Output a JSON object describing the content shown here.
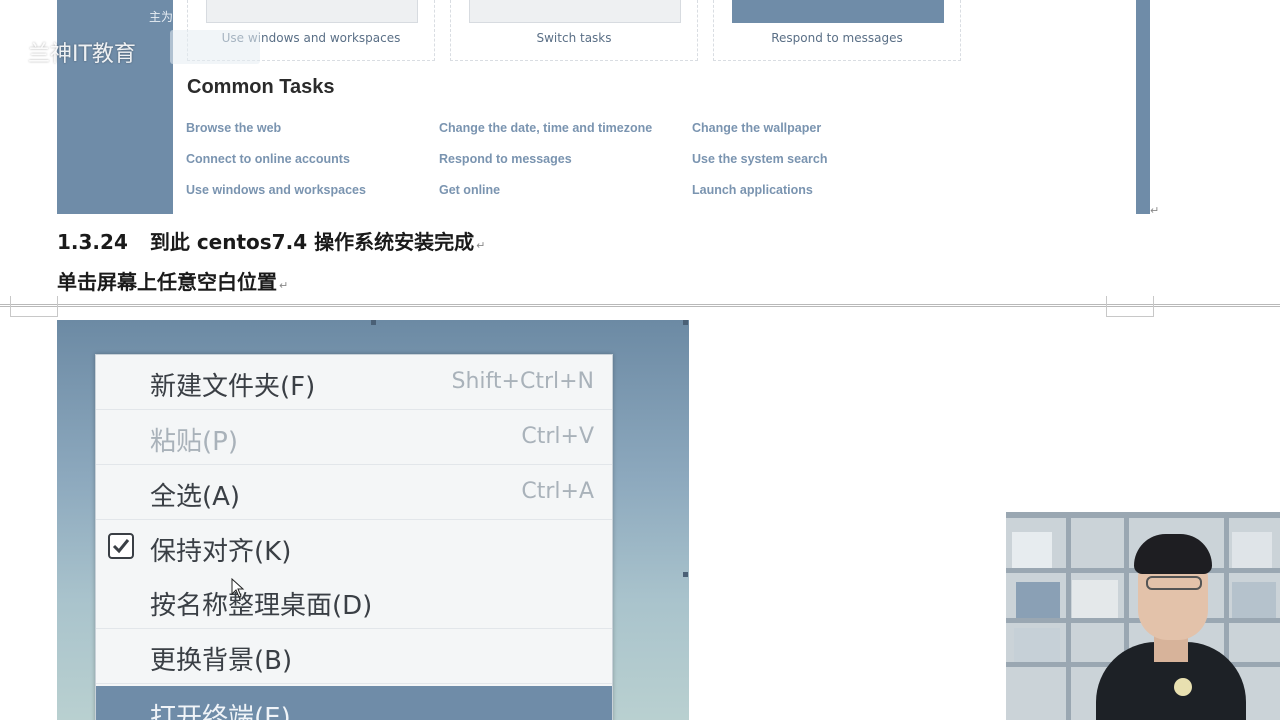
{
  "help_screenshot": {
    "sidebar_text": "主为",
    "cards": [
      {
        "caption": "Use windows and workspaces"
      },
      {
        "caption": "Switch tasks"
      },
      {
        "caption": "Respond to messages"
      }
    ],
    "common_tasks_title": "Common Tasks",
    "links": [
      [
        "Browse the web",
        "Change the date, time and timezone",
        "Change the wallpaper"
      ],
      [
        "Connect to online accounts",
        "Respond to messages",
        "Use the system search"
      ],
      [
        "Use windows and workspaces",
        "Get online",
        "Launch applications"
      ]
    ]
  },
  "watermark": {
    "text": "兰神IT教育"
  },
  "document": {
    "heading_number": "1.3.24",
    "heading_text": "到此 centos7.4 操作系统安装完成",
    "paragraph": "单击屏幕上任意空白位置",
    "para_mark": "↵"
  },
  "context_menu": {
    "items": [
      {
        "label": "新建文件夹(F)",
        "shortcut": "Shift+Ctrl+N",
        "disabled": false
      },
      {
        "label": "粘贴(P)",
        "shortcut": "Ctrl+V",
        "disabled": true
      },
      {
        "label": "全选(A)",
        "shortcut": "Ctrl+A",
        "disabled": false
      },
      {
        "label": "保持对齐(K)",
        "shortcut": "",
        "checked": true
      },
      {
        "label": "按名称整理桌面(D)",
        "shortcut": ""
      },
      {
        "label": "更换背景(B)",
        "shortcut": ""
      },
      {
        "label": "打开终端(E)",
        "shortcut": "",
        "highlighted": true
      }
    ]
  },
  "colors": {
    "accent": "#6f8ca8",
    "link": "#7a94b0",
    "menu_bg": "#f4f6f7"
  }
}
